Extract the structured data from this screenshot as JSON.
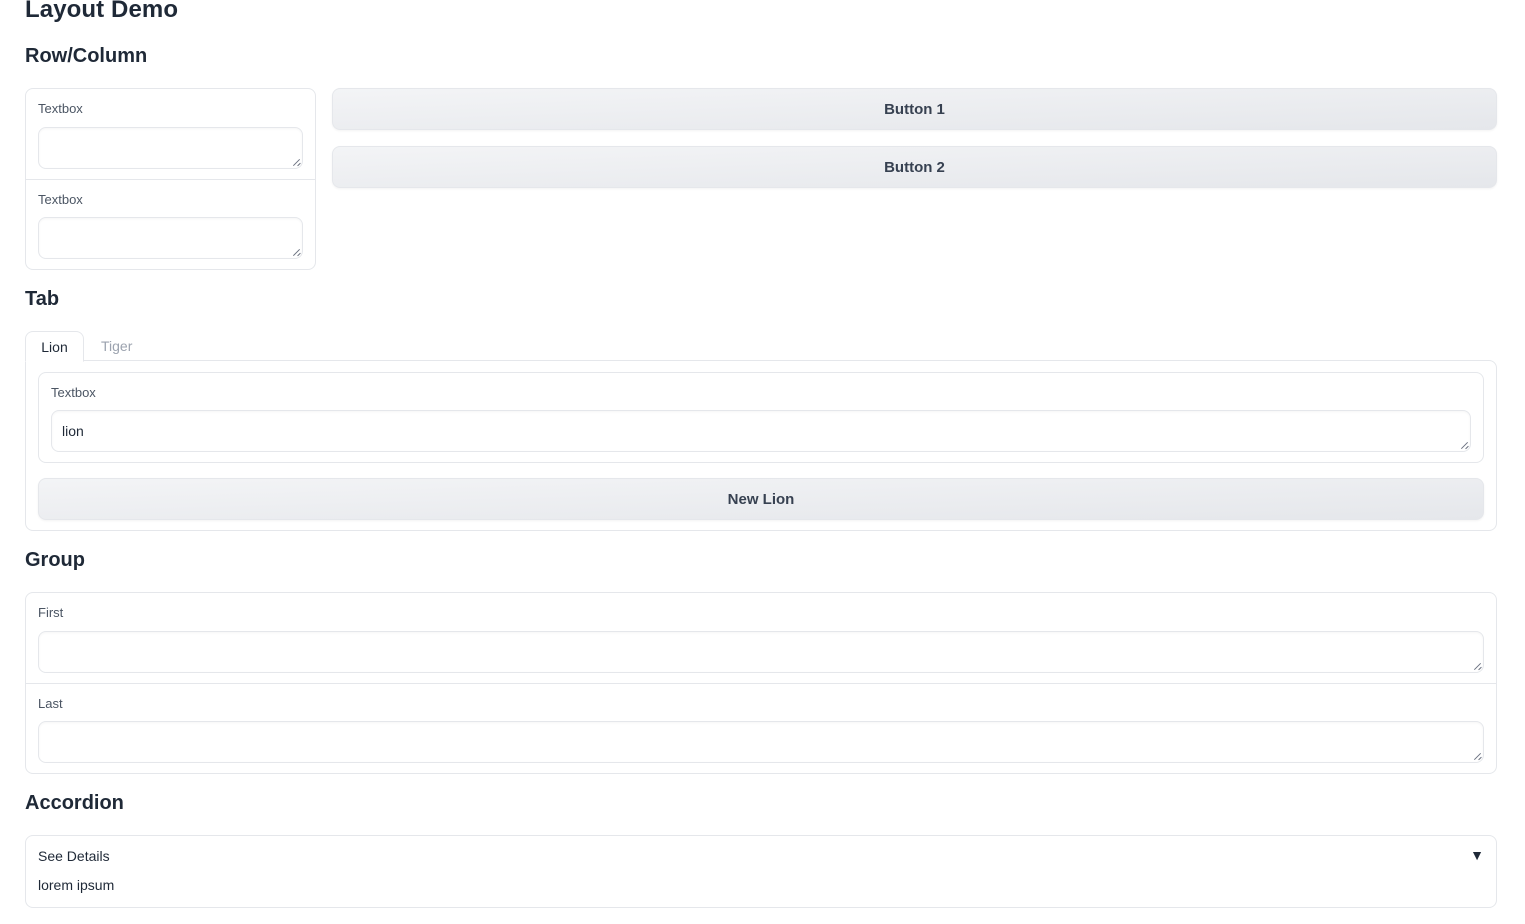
{
  "page": {
    "title": "Layout Demo"
  },
  "row_column": {
    "heading": "Row/Column",
    "textbox1": {
      "label": "Textbox",
      "value": ""
    },
    "textbox2": {
      "label": "Textbox",
      "value": ""
    },
    "button1_label": "Button 1",
    "button2_label": "Button 2"
  },
  "tab_section": {
    "heading": "Tab",
    "tabs": [
      {
        "label": "Lion",
        "selected": true
      },
      {
        "label": "Tiger",
        "selected": false
      }
    ],
    "textbox": {
      "label": "Textbox",
      "value": "lion"
    },
    "button_label": "New Lion"
  },
  "group": {
    "heading": "Group",
    "first": {
      "label": "First",
      "value": ""
    },
    "last": {
      "label": "Last",
      "value": ""
    }
  },
  "accordion": {
    "heading": "Accordion",
    "title": "See Details",
    "arrow": "▼",
    "content": "lorem ipsum",
    "expanded": true
  }
}
